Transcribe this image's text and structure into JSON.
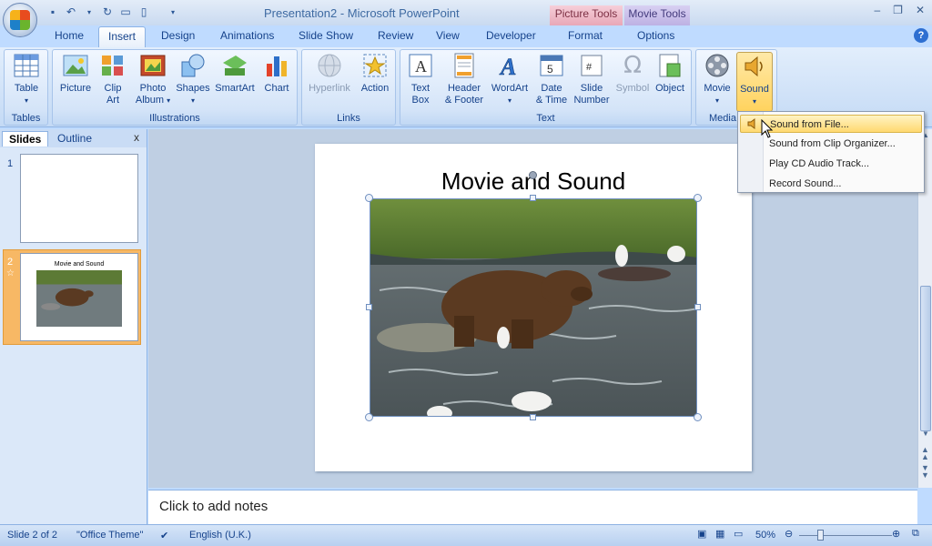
{
  "window": {
    "title": "Presentation2 - Microsoft PowerPoint",
    "context_picture": "Picture Tools",
    "context_movie": "Movie Tools",
    "minimize": "–",
    "restore": "❐",
    "close": "✕"
  },
  "tabs": [
    "Home",
    "Insert",
    "Design",
    "Animations",
    "Slide Show",
    "Review",
    "View",
    "Developer",
    "Format",
    "Options"
  ],
  "ribbon": {
    "tables": {
      "label": "Tables",
      "table": "Table"
    },
    "illustrations": {
      "label": "Illustrations",
      "picture": "Picture",
      "clip_art_1": "Clip",
      "clip_art_2": "Art",
      "photo_album_1": "Photo",
      "photo_album_2": "Album",
      "shapes": "Shapes",
      "smartart": "SmartArt",
      "chart": "Chart"
    },
    "links": {
      "label": "Links",
      "hyperlink": "Hyperlink",
      "action": "Action"
    },
    "text": {
      "label": "Text",
      "text_box_1": "Text",
      "text_box_2": "Box",
      "header_1": "Header",
      "header_2": "& Footer",
      "wordart": "WordArt",
      "date_1": "Date",
      "date_2": "& Time",
      "slide_num_1": "Slide",
      "slide_num_2": "Number",
      "symbol": "Symbol",
      "object": "Object"
    },
    "media": {
      "label": "Media",
      "movie": "Movie",
      "sound": "Sound"
    }
  },
  "sound_menu": [
    "Sound from File...",
    "Sound from Clip Organizer...",
    "Play CD Audio Track...",
    "Record Sound..."
  ],
  "pane": {
    "tab_slides": "Slides",
    "tab_outline": "Outline",
    "close": "x",
    "thumbs": [
      {
        "num": "1",
        "title": ""
      },
      {
        "num": "2",
        "title": "Movie and Sound"
      }
    ]
  },
  "slide": {
    "title": "Movie and Sound"
  },
  "notes": {
    "placeholder": "Click to add notes"
  },
  "status": {
    "slide": "Slide 2 of 2",
    "theme": "\"Office Theme\"",
    "language": "English (U.K.)",
    "zoom": "50%"
  }
}
